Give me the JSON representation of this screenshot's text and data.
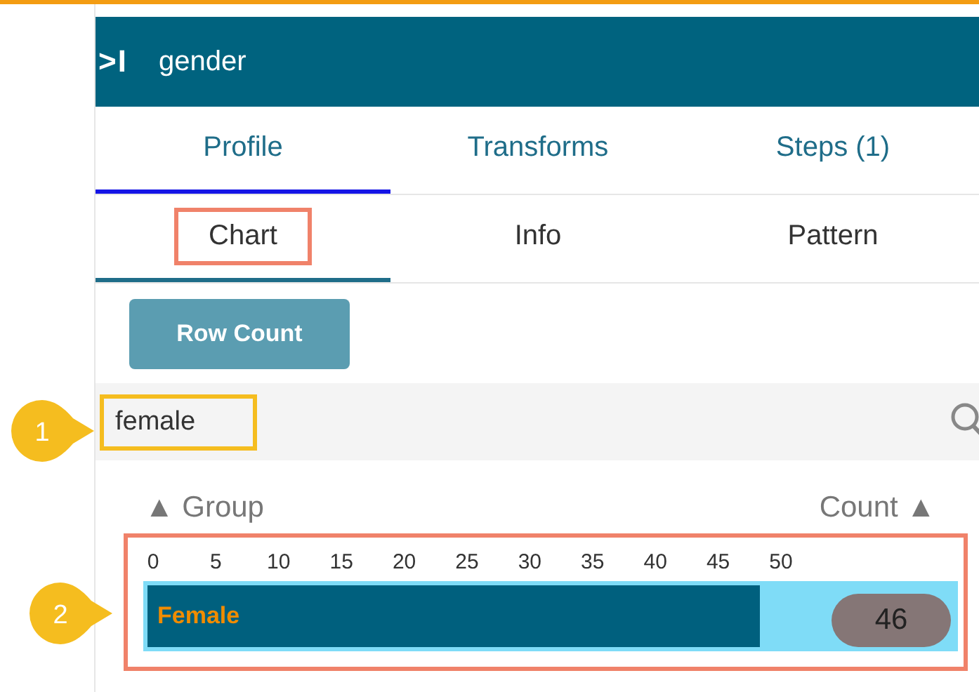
{
  "header": {
    "toggle": ">I",
    "title": "gender"
  },
  "tabs": [
    {
      "label": "Profile",
      "selected": true
    },
    {
      "label": "Transforms",
      "selected": false
    },
    {
      "label": "Steps (1)",
      "selected": false
    }
  ],
  "subtabs": [
    {
      "label": "Chart",
      "selected": true,
      "highlighted": true
    },
    {
      "label": "Info",
      "selected": false,
      "highlighted": false
    },
    {
      "label": "Pattern",
      "selected": false,
      "highlighted": false
    }
  ],
  "row_count_button": "Row Count",
  "search": {
    "value": "female",
    "highlighted": true
  },
  "columns": {
    "group": "▲ Group",
    "count": "Count ▲"
  },
  "chart": {
    "highlighted": true,
    "scale": [
      "0",
      "5",
      "10",
      "15",
      "20",
      "25",
      "30",
      "35",
      "40",
      "45",
      "50"
    ],
    "rows": [
      {
        "group": "Female",
        "count": "46",
        "level": 0.755
      }
    ]
  },
  "callouts": [
    {
      "number": "1"
    },
    {
      "number": "2"
    }
  ]
}
